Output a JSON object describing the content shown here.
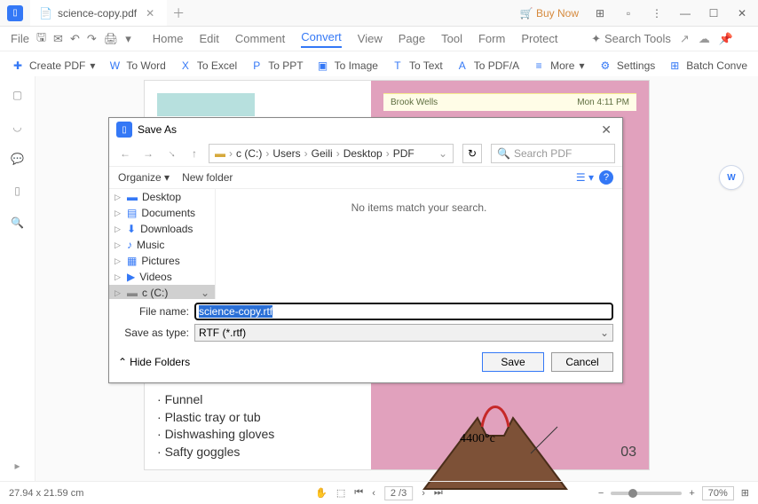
{
  "window": {
    "tab_title": "science-copy.pdf",
    "buy_now": "Buy Now"
  },
  "quick": {
    "file": "File"
  },
  "ribbon": {
    "home": "Home",
    "edit": "Edit",
    "comment": "Comment",
    "convert": "Convert",
    "view": "View",
    "page": "Page",
    "tool": "Tool",
    "form": "Form",
    "protect": "Protect",
    "search_tools": "Search Tools"
  },
  "actions": {
    "create_pdf": "Create PDF",
    "to_word": "To Word",
    "to_excel": "To Excel",
    "to_ppt": "To PPT",
    "to_image": "To Image",
    "to_text": "To Text",
    "to_pdfa": "To PDF/A",
    "more": "More",
    "settings": "Settings",
    "batch": "Batch Conve"
  },
  "document": {
    "bullets": [
      "Funnel",
      "Plastic tray or tub",
      "Dishwashing gloves",
      "Safty goggles"
    ],
    "temp": "4400°c",
    "page_num": "03",
    "note_name": "Brook Wells",
    "note_time": "Mon 4:11 PM"
  },
  "dialog": {
    "title": "Save As",
    "breadcrumb": [
      "c (C:)",
      "Users",
      "Geili",
      "Desktop",
      "PDF"
    ],
    "search_placeholder": "Search PDF",
    "organize": "Organize",
    "new_folder": "New folder",
    "tree": [
      "Desktop",
      "Documents",
      "Downloads",
      "Music",
      "Pictures",
      "Videos",
      "c (C:)"
    ],
    "empty_msg": "No items match your search.",
    "file_name_label": "File name:",
    "file_name_value": "science-copy.rtf",
    "type_label": "Save as type:",
    "type_value": "RTF (*.rtf)",
    "hide_folders": "Hide Folders",
    "save": "Save",
    "cancel": "Cancel"
  },
  "status": {
    "coords": "27.94 x 21.59 cm",
    "page_ind": "2 /3",
    "zoom": "70%"
  }
}
